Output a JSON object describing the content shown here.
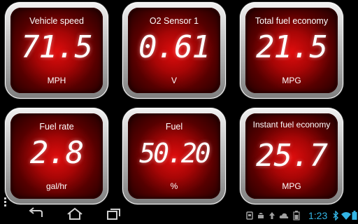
{
  "gauges": [
    {
      "title": "Vehicle speed",
      "value": "71.5",
      "unit": "MPH"
    },
    {
      "title": "O2 Sensor 1",
      "value": "0.61",
      "unit": "V"
    },
    {
      "title": "Total fuel economy",
      "value": "21.5",
      "unit": "MPG"
    },
    {
      "title": "Fuel rate",
      "value": "2.8",
      "unit": "gal/hr"
    },
    {
      "title": "Fuel",
      "value": "50.20",
      "unit": "%"
    },
    {
      "title": "Instant fuel economy",
      "value": "25.7",
      "unit": "MPG"
    }
  ],
  "status_bar": {
    "time": "1:23",
    "icons": [
      "obd-icon",
      "android-icon",
      "upload-icon",
      "cloud-icon",
      "wifi-icon",
      "bluetooth-icon",
      "battery-icon"
    ]
  },
  "navigation": {
    "buttons": [
      "back",
      "home",
      "recent-apps"
    ]
  },
  "colors": {
    "gauge_red": "#c10808",
    "clock_blue": "#33b5e5"
  }
}
